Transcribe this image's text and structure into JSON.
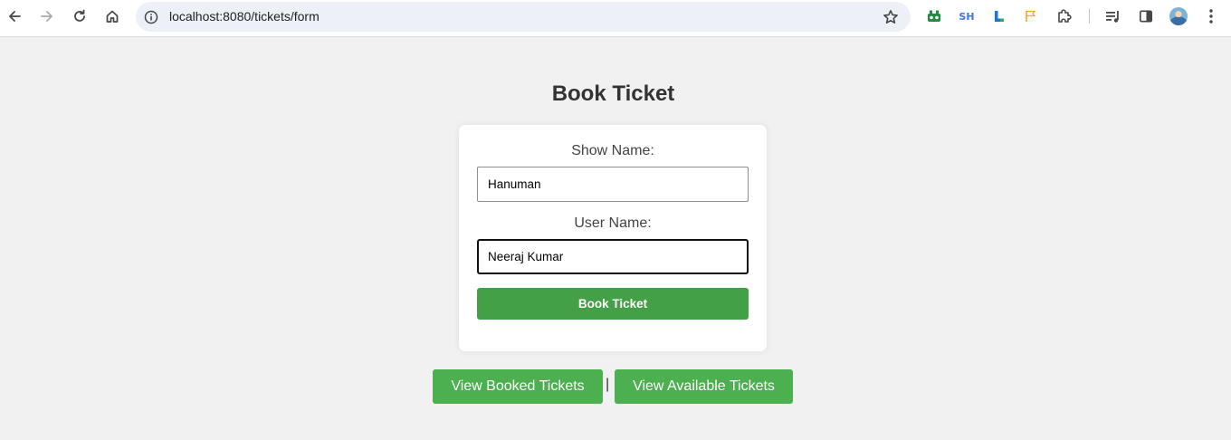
{
  "browser": {
    "url": "localhost:8080/tickets/form",
    "extensions": [
      {
        "name": "gear-robot-extension-icon",
        "color": "#1e8e3e"
      },
      {
        "name": "sh-extension-icon",
        "text": "SH",
        "color": "#3b78e7"
      },
      {
        "name": "l-extension-icon",
        "color": "#1a73e8"
      },
      {
        "name": "flag-extension-icon",
        "color": "#f5a623"
      }
    ]
  },
  "page": {
    "title": "Book Ticket"
  },
  "form": {
    "show_name_label": "Show Name:",
    "show_name_value": "Hanuman",
    "user_name_label": "User Name:",
    "user_name_value": "Neeraj Kumar",
    "submit_label": "Book Ticket"
  },
  "links": {
    "booked_label": "View Booked Tickets",
    "separator": "|",
    "available_label": "View Available Tickets"
  },
  "colors": {
    "submit_button": "#43a047",
    "nav_button": "#4caf50",
    "page_background": "#f1f1f1"
  }
}
